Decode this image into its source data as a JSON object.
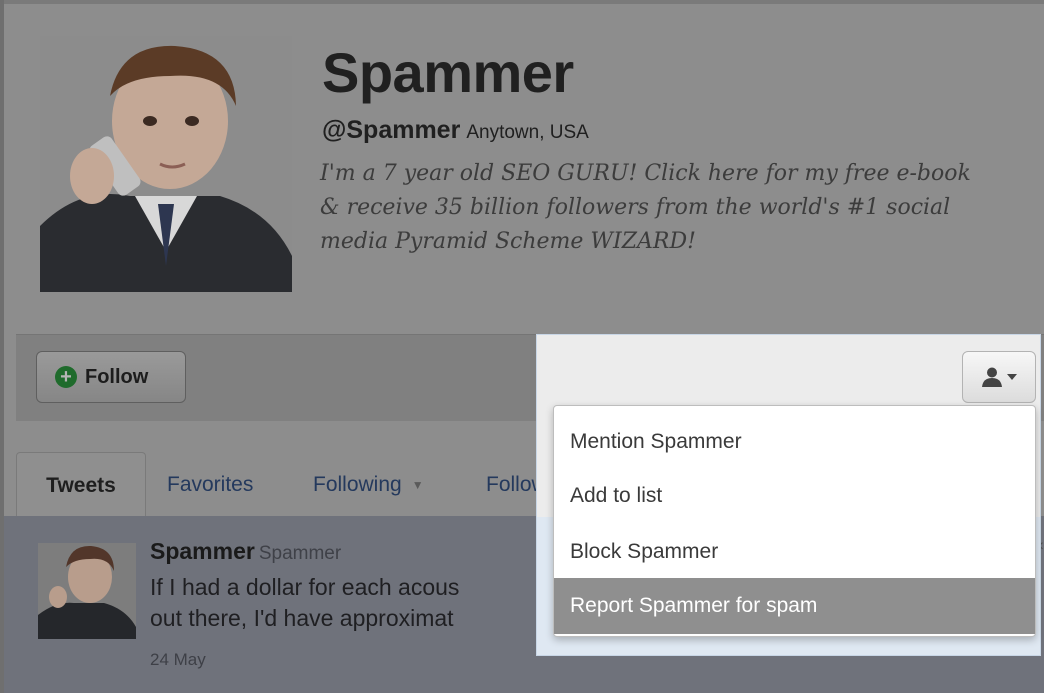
{
  "profile": {
    "name": "Spammer",
    "handle": "@Spammer",
    "location": "Anytown, USA",
    "bio": "I'm a 7 year old SEO GURU! Click here for my free e-book\n& receive 35 billion followers from the world's #1 social\nmedia Pyramid Scheme WIZARD!"
  },
  "actions": {
    "follow_label": "Follow"
  },
  "tabs": [
    {
      "label": "Tweets"
    },
    {
      "label": "Favorites"
    },
    {
      "label": "Following"
    },
    {
      "label": "Follow"
    }
  ],
  "tweet": {
    "author_name": "Spammer",
    "author_username": "Spammer",
    "text_line1": "If I had a dollar for each acous",
    "text_line2": "out there, I'd have approximat",
    "date": "24 May"
  },
  "user_menu": {
    "items": [
      {
        "label": "Mention Spammer"
      },
      {
        "label": "Add to list"
      },
      {
        "label": "Block Spammer"
      },
      {
        "label": "Report Spammer for spam"
      }
    ],
    "highlighted_index": 3
  },
  "colors": {
    "dim_overlay": "#8d8d8d",
    "menu_highlight": "#8f8f8f",
    "follow_plus": "#1f6b2c",
    "link_blue": "#24395d"
  }
}
